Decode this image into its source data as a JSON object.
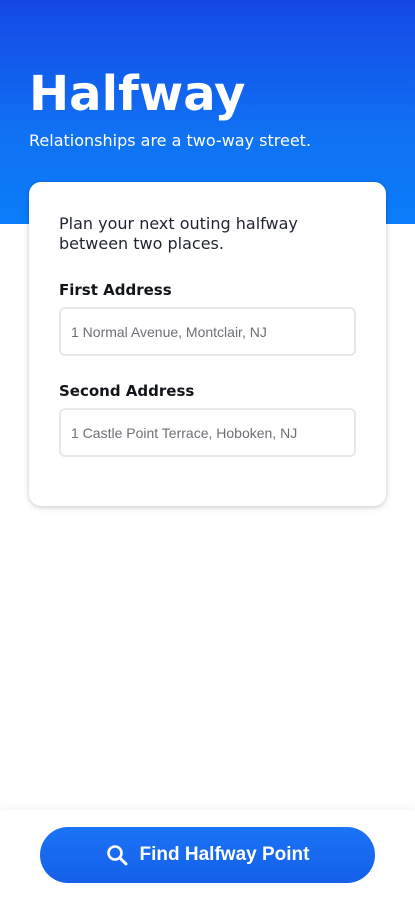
{
  "hero": {
    "title": "Halfway",
    "subtitle": "Relationships are a two-way street."
  },
  "card": {
    "intro": "Plan your next outing halfway between two places.",
    "first_address": {
      "label": "First Address",
      "placeholder": "1 Normal Avenue, Montclair, NJ",
      "value": ""
    },
    "second_address": {
      "label": "Second Address",
      "placeholder": "1 Castle Point Terrace, Hoboken, NJ",
      "value": ""
    }
  },
  "footer": {
    "button_label": "Find Halfway Point",
    "button_icon": "search-icon"
  },
  "colors": {
    "brand_blue": "#1565ee",
    "hero_gradient_top": "#1447e6",
    "hero_gradient_bottom": "#0b7dfa",
    "text_dark": "#111418",
    "input_border": "#e6e8ec"
  }
}
